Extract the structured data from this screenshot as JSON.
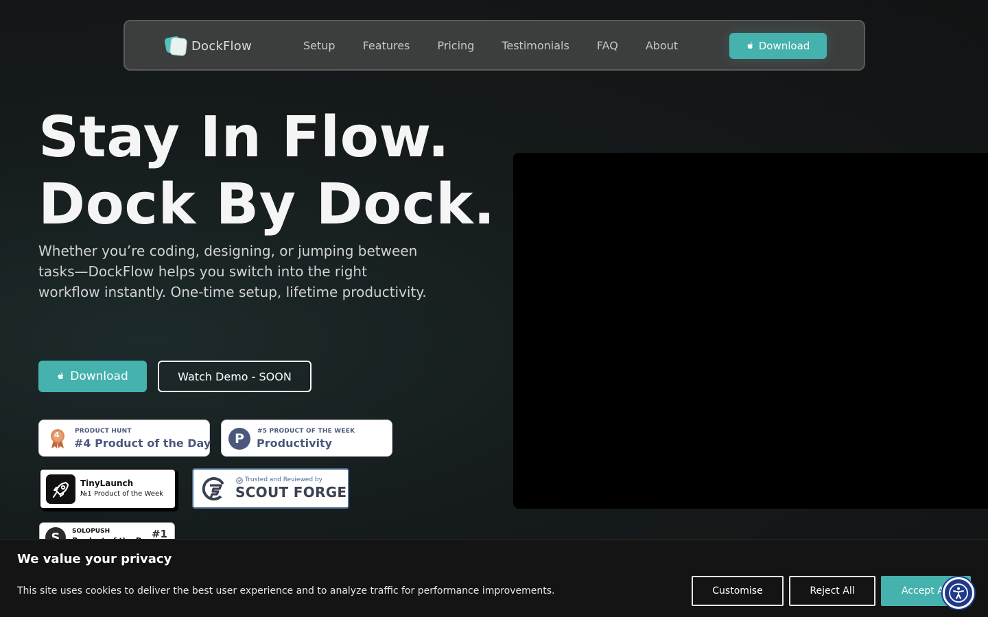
{
  "nav": {
    "logo_text": "DockFlow",
    "links": [
      "Setup",
      "Features",
      "Pricing",
      "Testimonials",
      "FAQ",
      "About"
    ],
    "download_label": "Download"
  },
  "hero": {
    "title_line1": "Stay In Flow.",
    "title_line2": "Dock By Dock.",
    "subtitle": "Whether you’re coding, designing, or jumping between tasks—DockFlow helps you switch into the right workflow instantly. One-time setup, lifetime productivity.",
    "download_label": "Download",
    "demo_label": "Watch Demo - SOON"
  },
  "badges": {
    "producthunt_day": {
      "medal_number": "4",
      "small": "PRODUCT HUNT",
      "big": "#4 Product of the Day"
    },
    "producthunt_week": {
      "icon_letter": "P",
      "small": "#5 PRODUCT OF THE WEEK",
      "big": "Productivity"
    },
    "tinylaunch": {
      "title": "TinyLaunch",
      "subtitle": "№1 Product of the Week"
    },
    "scoutforge": {
      "small": "Trusted and Reviewed by",
      "big": "SCOUT FORGE"
    },
    "solopush": {
      "icon_letter": "S",
      "small": "SOLOPUSH",
      "big": "Product of the Day",
      "rank": "#1"
    }
  },
  "cookie": {
    "title": "We value your privacy",
    "text": "This site uses cookies to deliver the best user experience and to analyze traffic for performance improvements.",
    "customise_label": "Customise",
    "reject_label": "Reject All",
    "accept_label": "Accept All"
  },
  "colors": {
    "accent": "#45b2ad",
    "background": "#151a1b",
    "badge_text": "#4b587c",
    "accessibility_button": "#1f3a8a"
  },
  "icons": {
    "logo": "dockflow-logo-icon",
    "apple": "apple-icon",
    "medal": "medal-icon",
    "rocket": "rocket-icon",
    "check": "check-circle-icon",
    "accessibility": "accessibility-icon"
  }
}
